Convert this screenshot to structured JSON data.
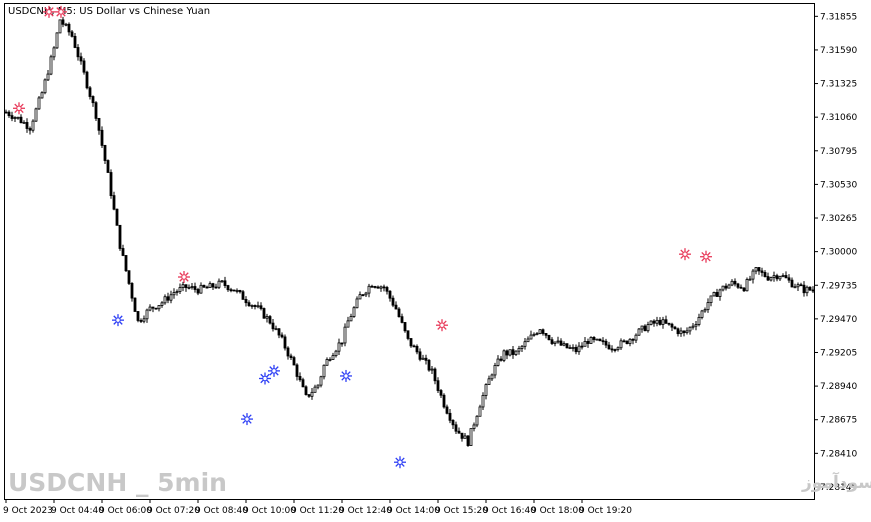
{
  "chart_data": {
    "type": "candlestick",
    "title": "USDCNH, M5:  US Dollar vs Chinese Yuan",
    "symbol": "USDCNH",
    "timeframe": "M5",
    "ylim": [
      7.2805,
      7.3196
    ],
    "y_ticks": [
      "7.31855",
      "7.31590",
      "7.31325",
      "7.31060",
      "7.30795",
      "7.30530",
      "7.30265",
      "7.30000",
      "7.29735",
      "7.29470",
      "7.29205",
      "7.28940",
      "7.28675",
      "7.28410",
      "7.28145"
    ],
    "x_ticks": [
      "9 Oct 2023",
      "9 Oct 04:40",
      "9 Oct 06:00",
      "9 Oct 07:20",
      "9 Oct 08:40",
      "9 Oct 10:00",
      "9 Oct 11:20",
      "9 Oct 12:40",
      "9 Oct 14:00",
      "9 Oct 15:20",
      "9 Oct 16:40",
      "9 Oct 18:00",
      "9 Oct 19:20"
    ],
    "grid": false,
    "colors": {
      "bull": "#000000",
      "bear": "#000000",
      "sell_arrow": "#e83a5a",
      "buy_arrow": "#2e3ff5"
    },
    "close_path": [
      [
        0,
        7.311
      ],
      [
        4,
        7.3105
      ],
      [
        8,
        7.3098
      ],
      [
        12,
        7.3125
      ],
      [
        16,
        7.316
      ],
      [
        18,
        7.3183
      ],
      [
        22,
        7.317
      ],
      [
        26,
        7.314
      ],
      [
        30,
        7.3108
      ],
      [
        34,
        7.306
      ],
      [
        38,
        7.3005
      ],
      [
        42,
        7.2965
      ],
      [
        44,
        7.2945
      ],
      [
        48,
        7.2955
      ],
      [
        52,
        7.296
      ],
      [
        56,
        7.2968
      ],
      [
        60,
        7.2972
      ],
      [
        64,
        7.297
      ],
      [
        68,
        7.2972
      ],
      [
        72,
        7.2975
      ],
      [
        76,
        7.297
      ],
      [
        80,
        7.2962
      ],
      [
        84,
        7.2955
      ],
      [
        88,
        7.2945
      ],
      [
        92,
        7.293
      ],
      [
        96,
        7.291
      ],
      [
        100,
        7.2885
      ],
      [
        104,
        7.2895
      ],
      [
        106,
        7.291
      ],
      [
        108,
        7.2918
      ],
      [
        112,
        7.293
      ],
      [
        114,
        7.2945
      ],
      [
        118,
        7.2965
      ],
      [
        122,
        7.2975
      ],
      [
        126,
        7.2972
      ],
      [
        130,
        7.2955
      ],
      [
        134,
        7.293
      ],
      [
        138,
        7.2918
      ],
      [
        142,
        7.2905
      ],
      [
        146,
        7.288
      ],
      [
        150,
        7.286
      ],
      [
        154,
        7.285
      ],
      [
        158,
        7.288
      ],
      [
        162,
        7.2905
      ],
      [
        166,
        7.292
      ],
      [
        170,
        7.292
      ],
      [
        174,
        7.293
      ],
      [
        178,
        7.294
      ],
      [
        182,
        7.293
      ],
      [
        186,
        7.2925
      ],
      [
        190,
        7.2922
      ],
      [
        194,
        7.293
      ],
      [
        198,
        7.2928
      ],
      [
        202,
        7.2925
      ],
      [
        206,
        7.2928
      ],
      [
        210,
        7.2935
      ],
      [
        214,
        7.2942
      ],
      [
        218,
        7.2945
      ],
      [
        222,
        7.294
      ],
      [
        226,
        7.2935
      ],
      [
        230,
        7.2945
      ],
      [
        234,
        7.296
      ],
      [
        238,
        7.297
      ],
      [
        242,
        7.2975
      ],
      [
        246,
        7.2972
      ],
      [
        250,
        7.2985
      ],
      [
        254,
        7.298
      ],
      [
        258,
        7.2982
      ],
      [
        262,
        7.2975
      ],
      [
        266,
        7.297
      ]
    ],
    "sell_arrows": [
      [
        3,
        7.3113
      ],
      [
        13,
        7.3189
      ],
      [
        17,
        7.3189
      ],
      [
        58,
        7.298
      ],
      [
        144,
        7.2942
      ],
      [
        225,
        7.2998
      ],
      [
        232,
        7.2996
      ]
    ],
    "buy_arrows": [
      [
        36,
        7.2946
      ],
      [
        79,
        7.2868
      ],
      [
        85,
        7.29
      ],
      [
        88,
        7.2906
      ],
      [
        112,
        7.2902
      ],
      [
        130,
        7.2834
      ]
    ]
  },
  "watermark": {
    "left": "USDCNH _ 5min",
    "right": "انتشار در سایت سودآموز"
  }
}
